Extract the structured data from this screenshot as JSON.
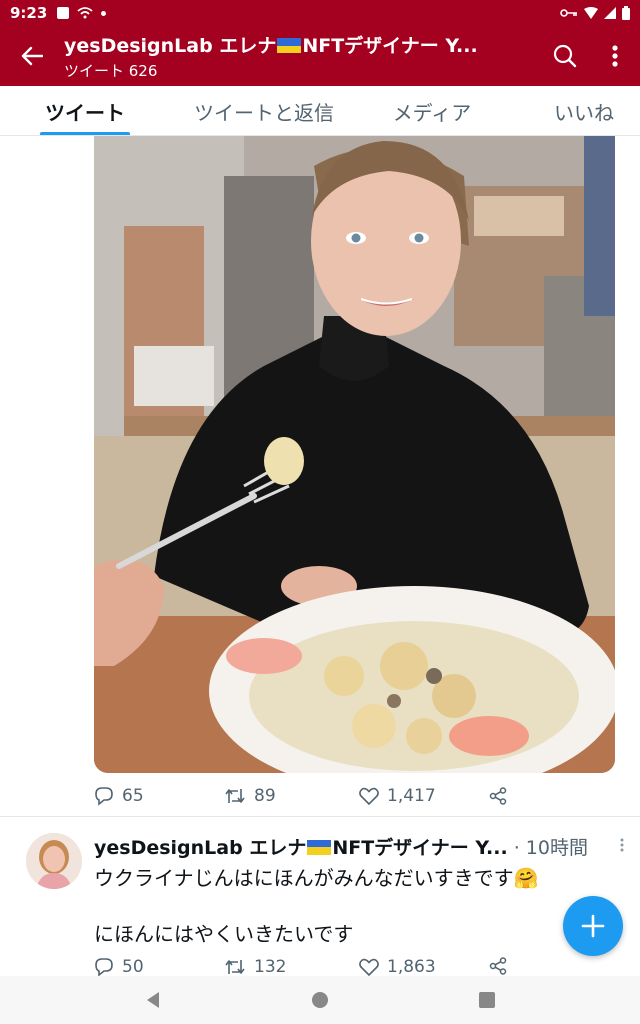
{
  "status_bar": {
    "time": "9:23"
  },
  "app_bar": {
    "title": "yesDesignLab エレナ🇺🇦NFTデザイナー Y...",
    "title_parts": [
      "yesDesignLab エレナ",
      "NFTデザイナー Y..."
    ],
    "subtitle": "ツイート 626",
    "accent": "#a4001f"
  },
  "tabs": [
    {
      "label": "ツイート",
      "active": true
    },
    {
      "label": "ツイートと返信",
      "active": false
    },
    {
      "label": "メディア",
      "active": false
    },
    {
      "label": "いいね",
      "active": false
    }
  ],
  "tweet1": {
    "stats": {
      "replies": "65",
      "retweets": "89",
      "likes": "1,417"
    }
  },
  "tweet2": {
    "name_parts": [
      "yesDesignLab エレナ",
      "NFTデザイナー Y..."
    ],
    "time": "· 10時間",
    "line1": "ウクライナじんはにほんがみんなだいすきです",
    "line1_emoji": "🤗",
    "line2": "にほんにはやくいきたいです",
    "stats": {
      "replies": "50",
      "retweets": "132",
      "likes": "1,863"
    }
  },
  "colors": {
    "accent_blue": "#1d9bf0",
    "muted": "#536471"
  }
}
